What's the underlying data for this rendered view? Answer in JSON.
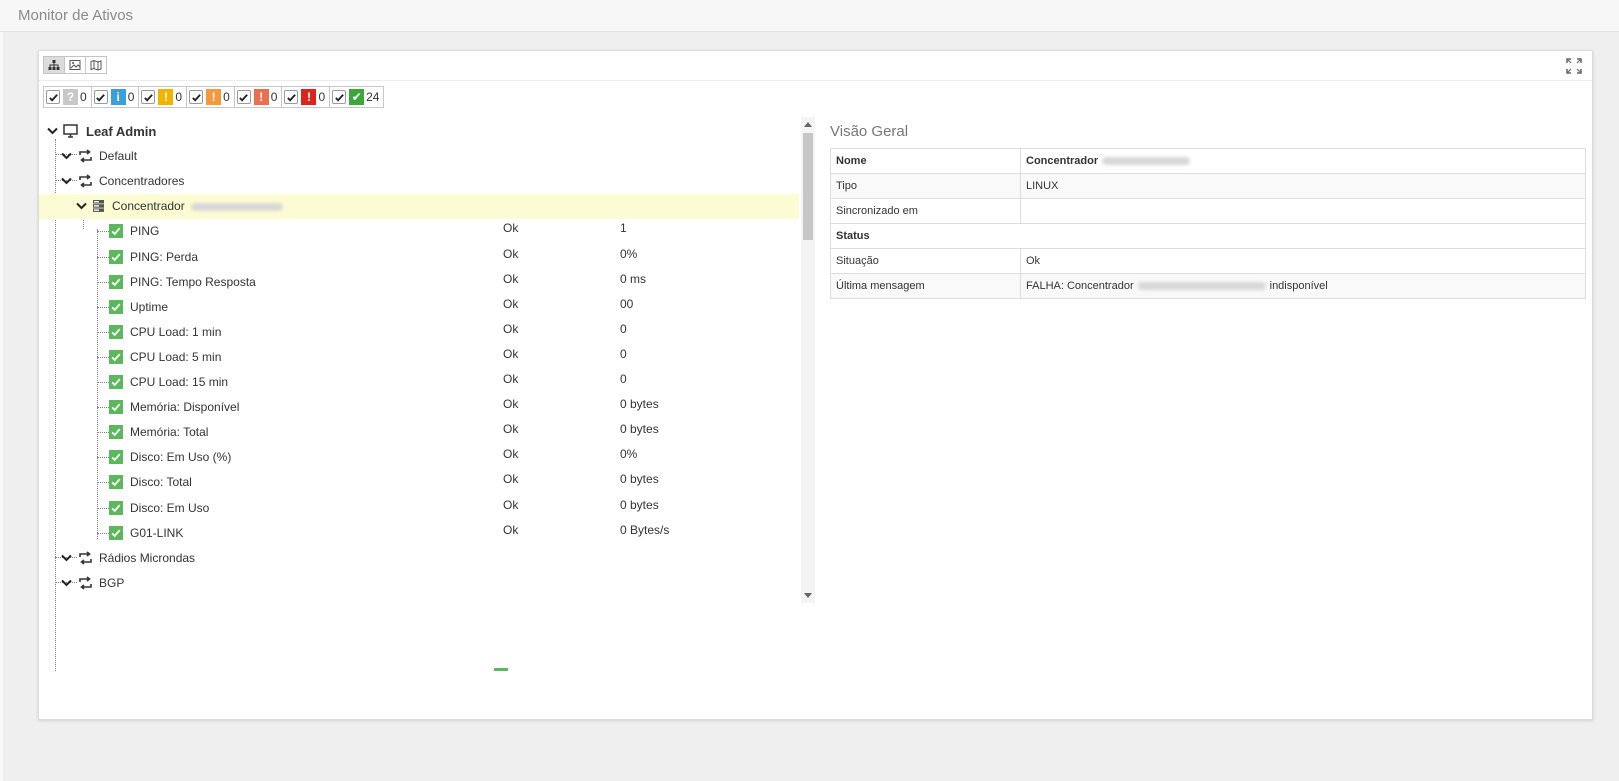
{
  "page": {
    "title": "Monitor de Ativos"
  },
  "view_toolbar": {
    "views": [
      {
        "icon": "tree-view-icon",
        "active": true
      },
      {
        "icon": "image-view-icon",
        "active": false
      },
      {
        "icon": "map-view-icon",
        "active": false
      }
    ],
    "fullscreen_icon": "expand-icon"
  },
  "filters": [
    {
      "icon": "question-icon",
      "glyph": "?",
      "color": "#c8c8c8",
      "count": "0"
    },
    {
      "icon": "info-icon",
      "glyph": "i",
      "color": "#3aa0d8",
      "count": "0"
    },
    {
      "icon": "warning-yellow-icon",
      "glyph": "!",
      "color": "#f0b400",
      "count": "0"
    },
    {
      "icon": "warning-orange-icon",
      "glyph": "!",
      "color": "#f49a3c",
      "count": "0"
    },
    {
      "icon": "alert-red-orange-icon",
      "glyph": "!",
      "color": "#e8704e",
      "count": "0"
    },
    {
      "icon": "alert-red-icon",
      "glyph": "!",
      "color": "#d9251c",
      "count": "0"
    },
    {
      "icon": "ok-icon",
      "glyph": "✔",
      "color": "#3ca83c",
      "count": "24"
    }
  ],
  "tree": {
    "root": {
      "label": "Leaf Admin",
      "icon": "monitor-icon"
    },
    "groups": [
      {
        "label": "Default",
        "icon": "group-loop-icon"
      },
      {
        "label": "Concentradores",
        "icon": "group-loop-icon"
      }
    ],
    "selected_node": {
      "label": "Concentrador",
      "icon": "server-icon"
    },
    "metrics": [
      {
        "label": "PING",
        "status": "Ok",
        "value": "1"
      },
      {
        "label": "PING: Perda",
        "status": "Ok",
        "value": "0%"
      },
      {
        "label": "PING: Tempo Resposta",
        "status": "Ok",
        "value": "0 ms"
      },
      {
        "label": "Uptime",
        "status": "Ok",
        "value": "00"
      },
      {
        "label": "CPU Load: 1 min",
        "status": "Ok",
        "value": "0"
      },
      {
        "label": "CPU Load: 5 min",
        "status": "Ok",
        "value": "0"
      },
      {
        "label": "CPU Load: 15 min",
        "status": "Ok",
        "value": "0"
      },
      {
        "label": "Memória: Disponível",
        "status": "Ok",
        "value": "0 bytes"
      },
      {
        "label": "Memória: Total",
        "status": "Ok",
        "value": "0 bytes"
      },
      {
        "label": "Disco: Em Uso (%)",
        "status": "Ok",
        "value": "0%"
      },
      {
        "label": "Disco: Total",
        "status": "Ok",
        "value": "0 bytes"
      },
      {
        "label": "Disco: Em Uso",
        "status": "Ok",
        "value": "0 bytes"
      },
      {
        "label": "G01-LINK",
        "status": "Ok",
        "value": "0 Bytes/s"
      }
    ],
    "more_groups": [
      {
        "label": "Rádios Microndas",
        "icon": "group-loop-icon"
      },
      {
        "label": "BGP",
        "icon": "group-loop-icon"
      }
    ]
  },
  "details": {
    "title": "Visão Geral",
    "rows": [
      {
        "key": "Nome",
        "value": "Concentrador",
        "bold": true,
        "blurred": true
      },
      {
        "key": "Tipo",
        "value": "LINUX"
      },
      {
        "key": "Sincronizado em",
        "value": ""
      },
      {
        "key": "Status",
        "header": true
      },
      {
        "key": "Situação",
        "value": "Ok"
      },
      {
        "key": "Última mensagem",
        "value_prefix": "FALHA: Concentrador",
        "value_suffix": "indisponível"
      }
    ]
  }
}
